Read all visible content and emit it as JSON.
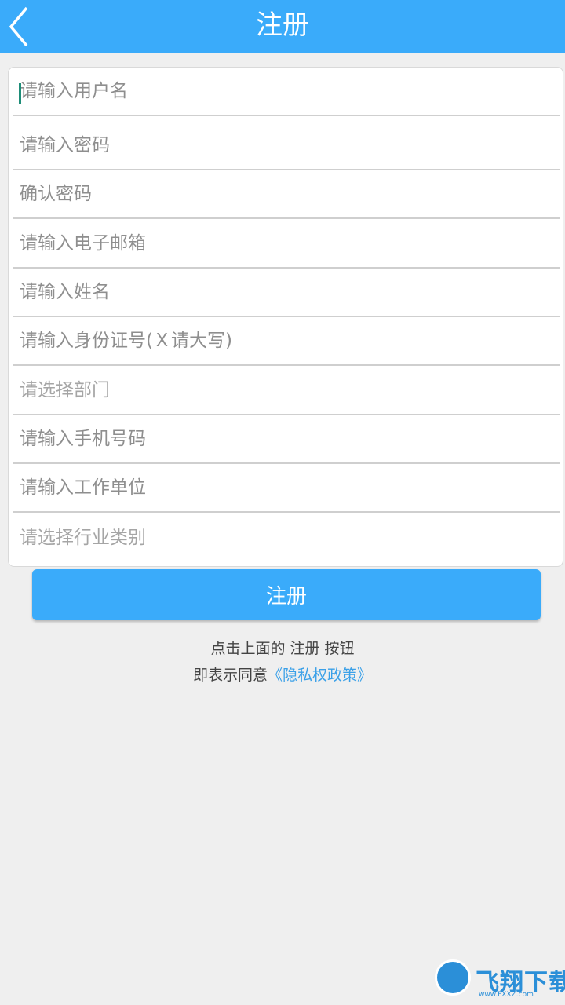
{
  "header": {
    "title": "注册",
    "back_icon": "chevron-left-icon"
  },
  "form": {
    "fields": [
      {
        "name": "username-input",
        "placeholder": "请输入用户名"
      },
      {
        "name": "password-input",
        "placeholder": "请输入密码"
      },
      {
        "name": "confirm-password-input",
        "placeholder": "确认密码"
      },
      {
        "name": "email-input",
        "placeholder": "请输入电子邮箱"
      },
      {
        "name": "name-input",
        "placeholder": "请输入姓名"
      },
      {
        "name": "id-number-input",
        "placeholder": "请输入身份证号(Ｘ请大写)"
      },
      {
        "name": "department-select",
        "placeholder": "请选择部门"
      },
      {
        "name": "phone-input",
        "placeholder": "请输入手机号码"
      },
      {
        "name": "work-unit-input",
        "placeholder": "请输入工作单位"
      },
      {
        "name": "industry-select",
        "placeholder": "请选择行业类别"
      }
    ]
  },
  "submit": {
    "label": "注册"
  },
  "notice": {
    "line1": "点击上面的 注册 按钮",
    "line2_prefix": "即表示同意",
    "privacy_link": "《隐私权政策》"
  },
  "watermark": {
    "text": "飞翔下载",
    "url": "www.FXXZ.com"
  },
  "colors": {
    "accent": "#3aabfa",
    "background": "#efefef",
    "link": "#3aa0e8",
    "caret": "#1e8d78"
  }
}
